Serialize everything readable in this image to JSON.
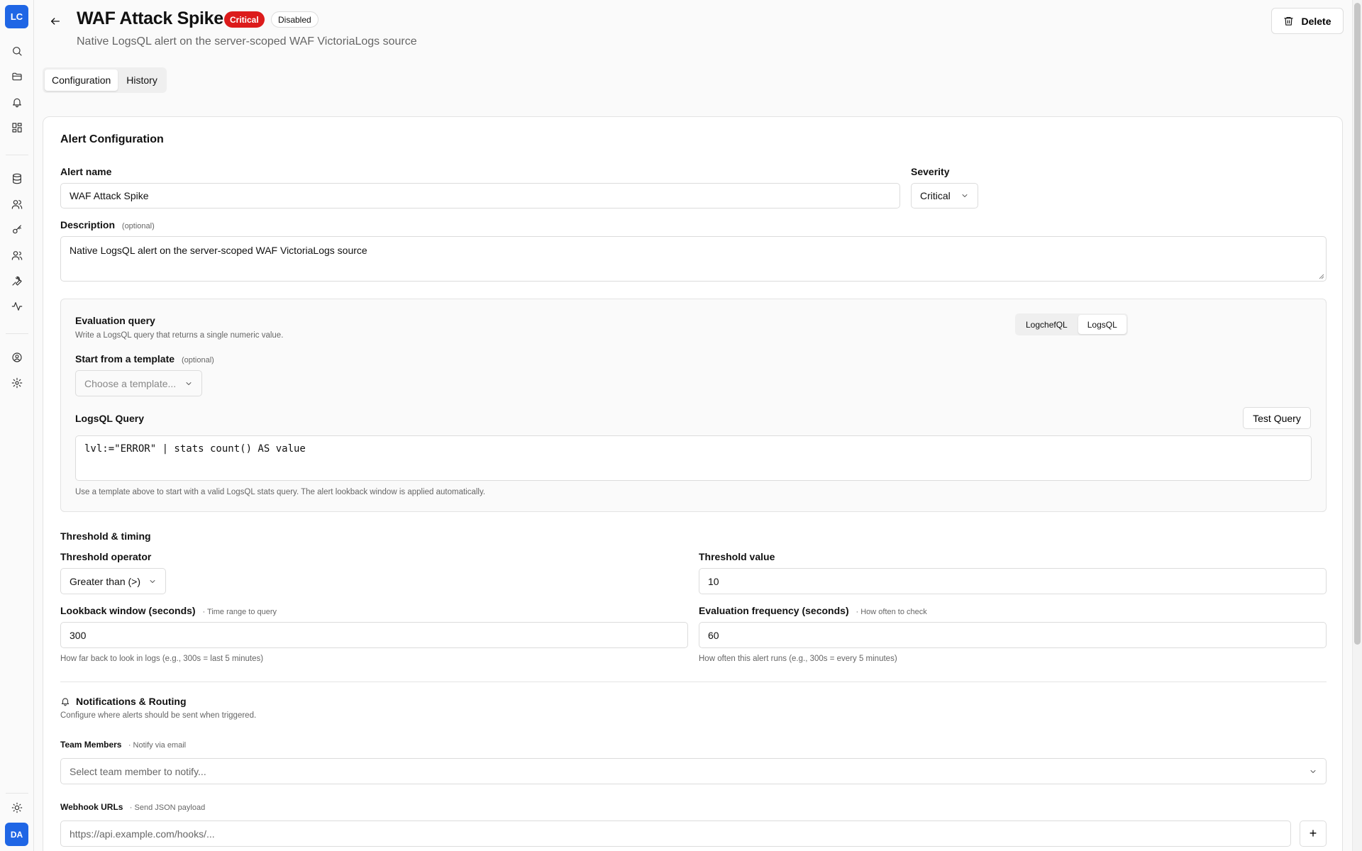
{
  "app": {
    "logo_initials": "LC",
    "user_initials": "DA"
  },
  "sidebar": {
    "icons": [
      "search-icon",
      "folder-icon",
      "bell-icon",
      "dashboard-icon",
      "database-icon",
      "users-icon",
      "key-icon",
      "team-icon",
      "wrench-icon",
      "activity-icon",
      "account-icon",
      "gear-icon",
      "theme-icon"
    ]
  },
  "header": {
    "title": "WAF Attack Spike",
    "severity_badge": "Critical",
    "status_badge": "Disabled",
    "subtitle": "Native LogsQL alert on the server-scoped WAF VictoriaLogs source",
    "delete_label": "Delete"
  },
  "tabs": [
    {
      "label": "Configuration",
      "active": true
    },
    {
      "label": "History",
      "active": false
    }
  ],
  "form": {
    "section_title": "Alert Configuration",
    "alert_name": {
      "label": "Alert name",
      "value": "WAF Attack Spike"
    },
    "severity": {
      "label": "Severity",
      "value": "Critical"
    },
    "description": {
      "label": "Description",
      "optional": "(optional)",
      "value": "Native LogsQL alert on the server-scoped WAF VictoriaLogs source"
    },
    "evaluation": {
      "title": "Evaluation query",
      "subtitle": "Write a LogsQL query that returns a single numeric value.",
      "modes": [
        "LogchefQL",
        "LogsQL"
      ],
      "active_mode": "LogsQL",
      "template_label": "Start from a template",
      "template_optional": "(optional)",
      "template_placeholder": "Choose a template...",
      "query_label": "LogsQL Query",
      "test_label": "Test Query",
      "query": "lvl:=\"ERROR\" | stats count() AS value",
      "helper": "Use a template above to start with a valid LogsQL stats query. The alert lookback window is applied automatically."
    },
    "threshold": {
      "section_title": "Threshold & timing",
      "operator_label": "Threshold operator",
      "operator_value": "Greater than (>)",
      "value_label": "Threshold value",
      "value": "10",
      "lookback_label": "Lookback window (seconds)",
      "lookback_hint": "· Time range to query",
      "lookback_value": "300",
      "lookback_helper": "How far back to look in logs (e.g., 300s = last 5 minutes)",
      "frequency_label": "Evaluation frequency (seconds)",
      "frequency_hint": "· How often to check",
      "frequency_value": "60",
      "frequency_helper": "How often this alert runs (e.g., 300s = every 5 minutes)"
    },
    "notifications": {
      "title": "Notifications & Routing",
      "subtitle": "Configure where alerts should be sent when triggered.",
      "team_label": "Team Members",
      "team_hint": "· Notify via email",
      "team_placeholder": "Select team member to notify...",
      "webhook_label": "Webhook URLs",
      "webhook_hint": "· Send JSON payload",
      "webhook_placeholder": "https://api.example.com/hooks/...",
      "add_label": "+"
    }
  },
  "colors": {
    "accent": "#1f66e5",
    "critical": "#dc1b1b"
  }
}
